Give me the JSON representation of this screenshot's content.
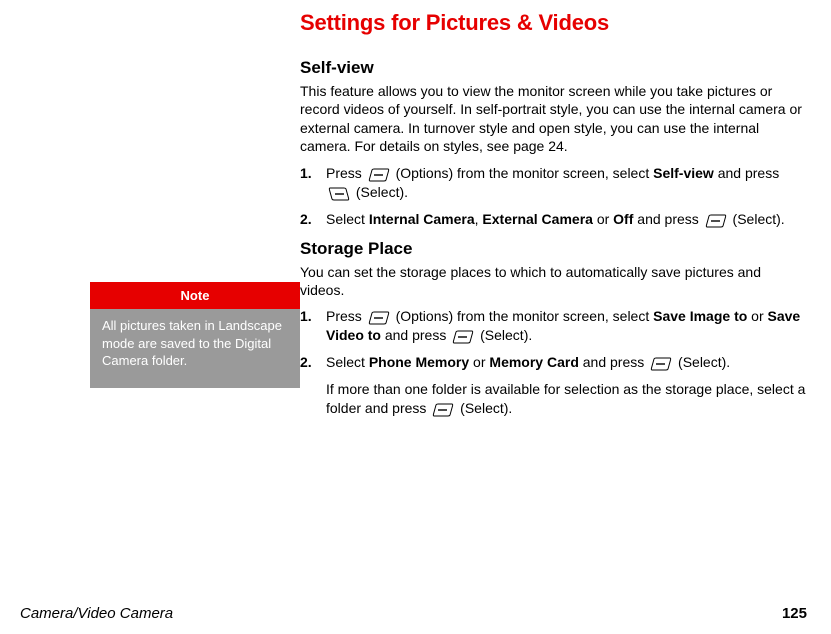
{
  "title": "Settings for Pictures & Videos",
  "note": {
    "label": "Note",
    "body": "All pictures taken in Landscape mode are saved to the Digital Camera folder."
  },
  "selfview": {
    "heading": "Self-view",
    "intro": "This feature allows you to view the monitor screen while you take pictures or record videos of yourself. In self-portrait style, you can use the internal camera or external camera. In turnover style and open style, you can use the internal camera. For details on styles, see page 24.",
    "step1": {
      "a": "Press ",
      "b": " (Options) from the monitor screen, select ",
      "bold1": "Self-view",
      "c": " and press ",
      "d": " (Select)."
    },
    "step2": {
      "a": "Select ",
      "bold1": "Internal Camera",
      "sep1": ", ",
      "bold2": "External Camera",
      "sep2": " or ",
      "bold3": "Off",
      "b": " and press ",
      "c": " (Select)."
    }
  },
  "storage": {
    "heading": "Storage Place",
    "intro": "You can set the storage places to which to automatically save pictures and videos.",
    "step1": {
      "a": "Press ",
      "b": " (Options) from the monitor screen, select ",
      "bold1": "Save Image to",
      "sep": " or ",
      "bold2": "Save Video to",
      "c": " and press ",
      "d": " (Select)."
    },
    "step2": {
      "a": "Select ",
      "bold1": "Phone Memory",
      "sep": " or ",
      "bold2": "Memory Card",
      "b": " and press ",
      "c": " (Select)."
    },
    "follow": {
      "a": "If more than one folder is available for selection as the storage place, select a folder and press ",
      "b": " (Select)."
    }
  },
  "footer": {
    "section": "Camera/Video Camera",
    "page": "125"
  }
}
